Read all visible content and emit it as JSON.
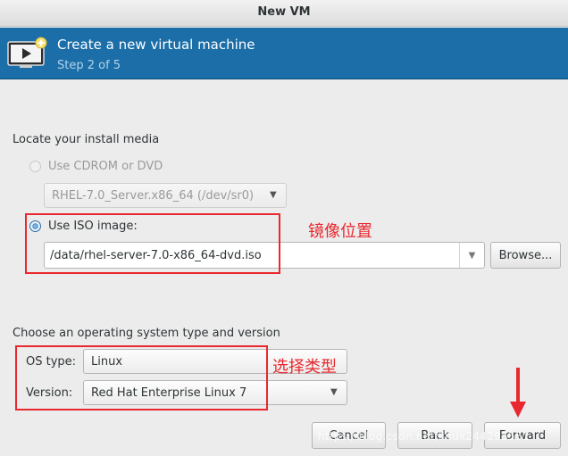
{
  "window": {
    "title": "New VM"
  },
  "banner": {
    "headline": "Create a new virtual machine",
    "step": "Step 2 of 5",
    "icon": "virtual-machine-monitor-icon",
    "background_color": "#1b6ea8"
  },
  "install_media": {
    "section_label": "Locate your install media",
    "cdrom_option": {
      "label": "Use CDROM or DVD",
      "selected": false,
      "enabled": false
    },
    "cdrom_device": {
      "value": "RHEL-7.0_Server.x86_64 (/dev/sr0)",
      "enabled": false
    },
    "iso_option": {
      "label": "Use ISO image:",
      "selected": true,
      "enabled": true
    },
    "iso_path": {
      "value": "/data/rhel-server-7.0-x86_64-dvd.iso"
    },
    "browse_label": "Browse..."
  },
  "os_section": {
    "section_label": "Choose an operating system type and version",
    "os_type_label": "OS type:",
    "os_type_value": "Linux",
    "version_label": "Version:",
    "version_value": "Red Hat Enterprise Linux 7"
  },
  "footer": {
    "cancel_label": "Cancel",
    "back_label": "Back",
    "forward_label": "Forward"
  },
  "annotations": {
    "iso_note": "镜像位置",
    "type_note": "选择类型",
    "color": "#e8282e"
  },
  "watermark": "https://blog.csdn.net/linux244295551"
}
